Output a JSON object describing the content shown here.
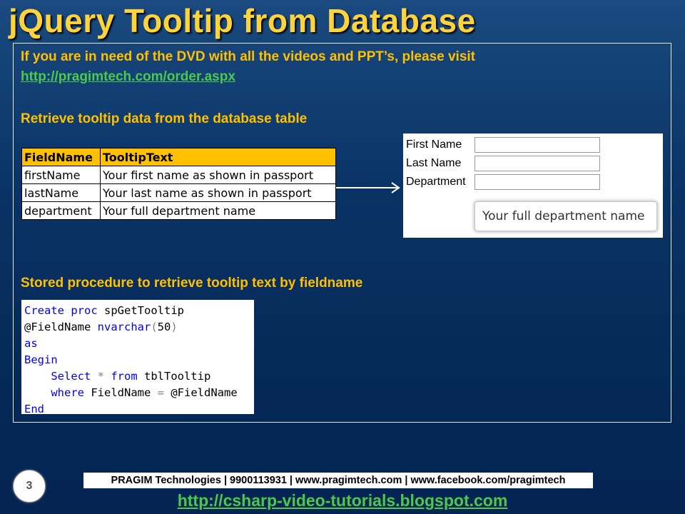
{
  "slide": {
    "title": "jQuery Tooltip from Database",
    "intro_text": "If you are in need of the DVD with all the videos and PPT’s, please visit",
    "intro_link": "http://pragimtech.com/order.aspx",
    "section1_heading": "Retrieve tooltip data from the database table",
    "section2_heading": "Stored procedure to retrieve tooltip text by fieldname"
  },
  "table": {
    "headers": [
      "FieldName",
      "TooltipText"
    ],
    "rows": [
      [
        "firstName",
        "Your first name as shown in passport"
      ],
      [
        "lastName",
        "Your last name as shown in passport"
      ],
      [
        "department",
        "Your full department name"
      ]
    ]
  },
  "form_demo": {
    "fields": [
      {
        "label": "First Name",
        "value": ""
      },
      {
        "label": "Last Name",
        "value": ""
      },
      {
        "label": "Department",
        "value": ""
      }
    ],
    "tooltip": "Your full department name"
  },
  "code": {
    "line1": {
      "kw1": "Create",
      "kw2": "proc",
      "rest": " spGetTooltip"
    },
    "line2": {
      "param": "@FieldName ",
      "type": "nvarchar",
      "open": "(",
      "num": "50",
      "close": ")"
    },
    "line3": {
      "kw": "as"
    },
    "line4": {
      "kw": "Begin"
    },
    "line5": {
      "indent": "    ",
      "kw1": "Select",
      "star": " * ",
      "kw2": "from",
      "rest": " tblTooltip"
    },
    "line6": {
      "indent": "    ",
      "kw": "where",
      "rest1": " FieldName ",
      "eq": "=",
      "rest2": " @FieldName"
    },
    "line7": {
      "kw": "End"
    }
  },
  "footer": {
    "page_number": "3",
    "info": "PRAGIM Technologies | 9900113931 | www.pragimtech.com | www.facebook.com/pragimtech",
    "link": "http://csharp-video-tutorials.blogspot.com"
  },
  "colors": {
    "title": "#ffd43b",
    "heading": "#ffc000",
    "link": "#4cc94c",
    "table_header": "#ffc000",
    "code_keyword": "#0000ff",
    "background": "#0a3466"
  }
}
